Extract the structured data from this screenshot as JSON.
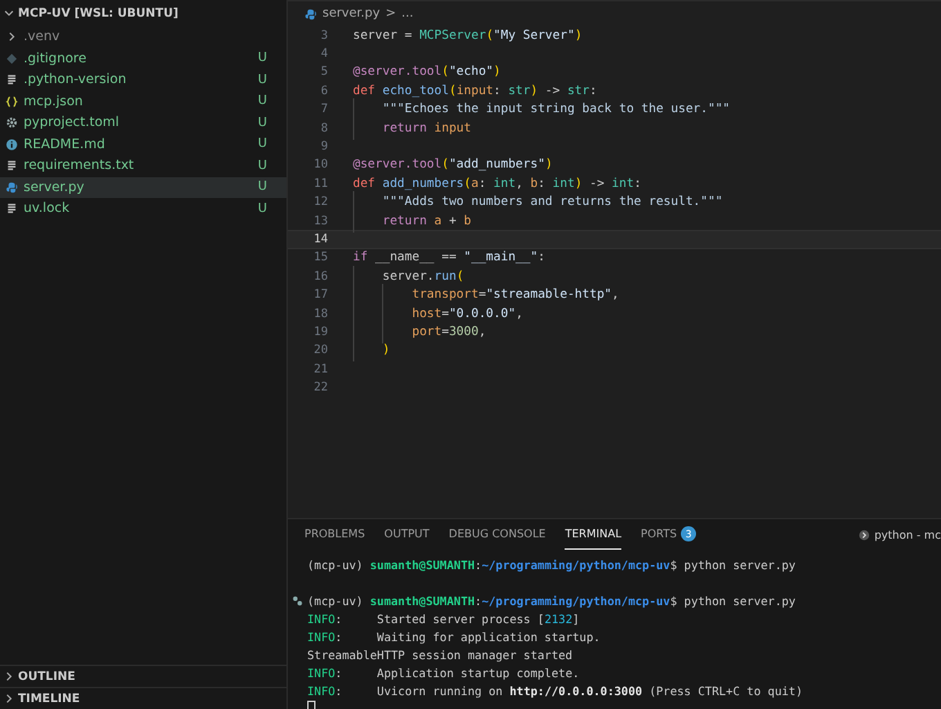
{
  "explorer": {
    "title": "MCP-UV [WSL: UBUNTU]",
    "expanded": true,
    "files": [
      {
        "name": ".venv",
        "kind": "folder",
        "expanded": false,
        "selected": false
      },
      {
        "name": ".gitignore",
        "kind": "gitignore",
        "status": "U",
        "selected": false
      },
      {
        "name": ".python-version",
        "kind": "text",
        "status": "U",
        "selected": false
      },
      {
        "name": "mcp.json",
        "kind": "json",
        "status": "U",
        "selected": false
      },
      {
        "name": "pyproject.toml",
        "kind": "config",
        "status": "U",
        "selected": false
      },
      {
        "name": "README.md",
        "kind": "readme",
        "status": "U",
        "selected": false
      },
      {
        "name": "requirements.txt",
        "kind": "text",
        "status": "U",
        "selected": false
      },
      {
        "name": "server.py",
        "kind": "python",
        "status": "U",
        "selected": true
      },
      {
        "name": "uv.lock",
        "kind": "text",
        "status": "U",
        "selected": false
      }
    ],
    "sections": [
      {
        "title": "OUTLINE",
        "expanded": false
      },
      {
        "title": "TIMELINE",
        "expanded": false
      }
    ]
  },
  "breadcrumb": {
    "file": "server.py",
    "separator": ">",
    "rest": "..."
  },
  "code_lines": [
    {
      "number": "3",
      "current": false,
      "tokens": [
        {
          "kind": "plain",
          "text": "server = "
        },
        {
          "kind": "class",
          "text": "MCPServer"
        },
        {
          "kind": "bracket",
          "text": "("
        },
        {
          "kind": "string",
          "text": "\"My Server\""
        },
        {
          "kind": "bracket",
          "text": ")"
        }
      ]
    },
    {
      "number": "4",
      "current": false
    },
    {
      "number": "5",
      "current": false,
      "tokens": [
        {
          "kind": "decorator",
          "text": "@server.tool"
        },
        {
          "kind": "bracket",
          "text": "("
        },
        {
          "kind": "string",
          "text": "\"echo\""
        },
        {
          "kind": "bracket",
          "text": ")"
        }
      ]
    },
    {
      "number": "6",
      "current": false,
      "tokens": [
        {
          "kind": "storage",
          "text": "def "
        },
        {
          "kind": "func",
          "text": "echo_tool"
        },
        {
          "kind": "bracket",
          "text": "("
        },
        {
          "kind": "param",
          "text": "input"
        },
        {
          "kind": "plain",
          "text": ": "
        },
        {
          "kind": "type",
          "text": "str"
        },
        {
          "kind": "bracket",
          "text": ")"
        },
        {
          "kind": "plain",
          "text": " -> "
        },
        {
          "kind": "type",
          "text": "str"
        },
        {
          "kind": "plain",
          "text": ":"
        }
      ]
    },
    {
      "number": "7",
      "current": false,
      "tokens": [
        {
          "kind": "doc",
          "text": "    \"\"\"Echoes the input string back to the user.\"\"\""
        }
      ]
    },
    {
      "number": "8",
      "current": false,
      "tokens": [
        {
          "kind": "keyword",
          "text": "    return "
        },
        {
          "kind": "param",
          "text": "input"
        }
      ]
    },
    {
      "number": "9",
      "current": false
    },
    {
      "number": "10",
      "current": false,
      "tokens": [
        {
          "kind": "decorator",
          "text": "@server.tool"
        },
        {
          "kind": "bracket",
          "text": "("
        },
        {
          "kind": "string",
          "text": "\"add_numbers\""
        },
        {
          "kind": "bracket",
          "text": ")"
        }
      ]
    },
    {
      "number": "11",
      "current": false,
      "tokens": [
        {
          "kind": "storage",
          "text": "def "
        },
        {
          "kind": "func",
          "text": "add_numbers"
        },
        {
          "kind": "bracket",
          "text": "("
        },
        {
          "kind": "param",
          "text": "a"
        },
        {
          "kind": "plain",
          "text": ": "
        },
        {
          "kind": "type",
          "text": "int"
        },
        {
          "kind": "plain",
          "text": ", "
        },
        {
          "kind": "param",
          "text": "b"
        },
        {
          "kind": "plain",
          "text": ": "
        },
        {
          "kind": "type",
          "text": "int"
        },
        {
          "kind": "bracket",
          "text": ")"
        },
        {
          "kind": "plain",
          "text": " -> "
        },
        {
          "kind": "type",
          "text": "int"
        },
        {
          "kind": "plain",
          "text": ":"
        }
      ]
    },
    {
      "number": "12",
      "current": false,
      "tokens": [
        {
          "kind": "doc",
          "text": "    \"\"\"Adds two numbers and returns the result.\"\"\""
        }
      ]
    },
    {
      "number": "13",
      "current": false,
      "tokens": [
        {
          "kind": "keyword",
          "text": "    return "
        },
        {
          "kind": "param",
          "text": "a"
        },
        {
          "kind": "plain",
          "text": " + "
        },
        {
          "kind": "param",
          "text": "b"
        }
      ]
    },
    {
      "number": "14",
      "current": true
    },
    {
      "number": "15",
      "current": false,
      "tokens": [
        {
          "kind": "keyword",
          "text": "if "
        },
        {
          "kind": "plain",
          "text": "__name__ == "
        },
        {
          "kind": "string",
          "text": "\"__main__\""
        },
        {
          "kind": "plain",
          "text": ":"
        }
      ]
    },
    {
      "number": "16",
      "current": false,
      "tokens": [
        {
          "kind": "plain",
          "text": "    server."
        },
        {
          "kind": "func",
          "text": "run"
        },
        {
          "kind": "bracket",
          "text": "("
        }
      ]
    },
    {
      "number": "17",
      "current": false,
      "tokens": [
        {
          "kind": "param",
          "text": "        transport"
        },
        {
          "kind": "plain",
          "text": "="
        },
        {
          "kind": "string",
          "text": "\"streamable-http\""
        },
        {
          "kind": "plain",
          "text": ","
        }
      ]
    },
    {
      "number": "18",
      "current": false,
      "tokens": [
        {
          "kind": "param",
          "text": "        host"
        },
        {
          "kind": "plain",
          "text": "="
        },
        {
          "kind": "string",
          "text": "\"0.0.0.0\""
        },
        {
          "kind": "plain",
          "text": ","
        }
      ]
    },
    {
      "number": "19",
      "current": false,
      "tokens": [
        {
          "kind": "param",
          "text": "        port"
        },
        {
          "kind": "plain",
          "text": "="
        },
        {
          "kind": "number",
          "text": "3000"
        },
        {
          "kind": "plain",
          "text": ","
        }
      ]
    },
    {
      "number": "20",
      "current": false,
      "tokens": [
        {
          "kind": "bracket",
          "text": "    )"
        }
      ]
    },
    {
      "number": "21",
      "current": false
    },
    {
      "number": "22",
      "current": false
    }
  ],
  "panel_tabs": [
    {
      "label": "PROBLEMS",
      "selected": false
    },
    {
      "label": "OUTPUT",
      "selected": false
    },
    {
      "label": "DEBUG CONSOLE",
      "selected": false
    },
    {
      "label": "TERMINAL",
      "selected": true
    },
    {
      "label": "PORTS",
      "badge": "3",
      "selected": false
    }
  ],
  "terminal_name": "python - mc",
  "terminal_lines": [
    {
      "marker": false,
      "tokens": [
        {
          "kind": "plain",
          "text": "(mcp-uv) "
        },
        {
          "kind": "user",
          "text": "sumanth@SUMANTH"
        },
        {
          "kind": "plain",
          "text": ":"
        },
        {
          "kind": "path",
          "text": "~/programming/python/mcp-uv"
        },
        {
          "kind": "plain",
          "text": "$ python server.py"
        }
      ]
    },
    {
      "marker": false
    },
    {
      "marker": true,
      "tokens": [
        {
          "kind": "plain",
          "text": "(mcp-uv) "
        },
        {
          "kind": "user",
          "text": "sumanth@SUMANTH"
        },
        {
          "kind": "plain",
          "text": ":"
        },
        {
          "kind": "path",
          "text": "~/programming/python/mcp-uv"
        },
        {
          "kind": "plain",
          "text": "$ python server.py"
        }
      ]
    },
    {
      "marker": false,
      "tokens": [
        {
          "kind": "info",
          "text": "INFO"
        },
        {
          "kind": "plain",
          "text": ":     Started server process ["
        },
        {
          "kind": "num",
          "text": "2132"
        },
        {
          "kind": "plain",
          "text": "]"
        }
      ]
    },
    {
      "marker": false,
      "tokens": [
        {
          "kind": "info",
          "text": "INFO"
        },
        {
          "kind": "plain",
          "text": ":     Waiting for application startup."
        }
      ]
    },
    {
      "marker": false,
      "tokens": [
        {
          "kind": "plain",
          "text": "StreamableHTTP session manager started"
        }
      ]
    },
    {
      "marker": false,
      "tokens": [
        {
          "kind": "info",
          "text": "INFO"
        },
        {
          "kind": "plain",
          "text": ":     Application startup complete."
        }
      ]
    },
    {
      "marker": false,
      "tokens": [
        {
          "kind": "info",
          "text": "INFO"
        },
        {
          "kind": "plain",
          "text": ":     Uvicorn running on "
        },
        {
          "kind": "bold",
          "text": "http://0.0.0.0:3000"
        },
        {
          "kind": "plain",
          "text": " (Press CTRL+C to quit)"
        }
      ]
    }
  ]
}
